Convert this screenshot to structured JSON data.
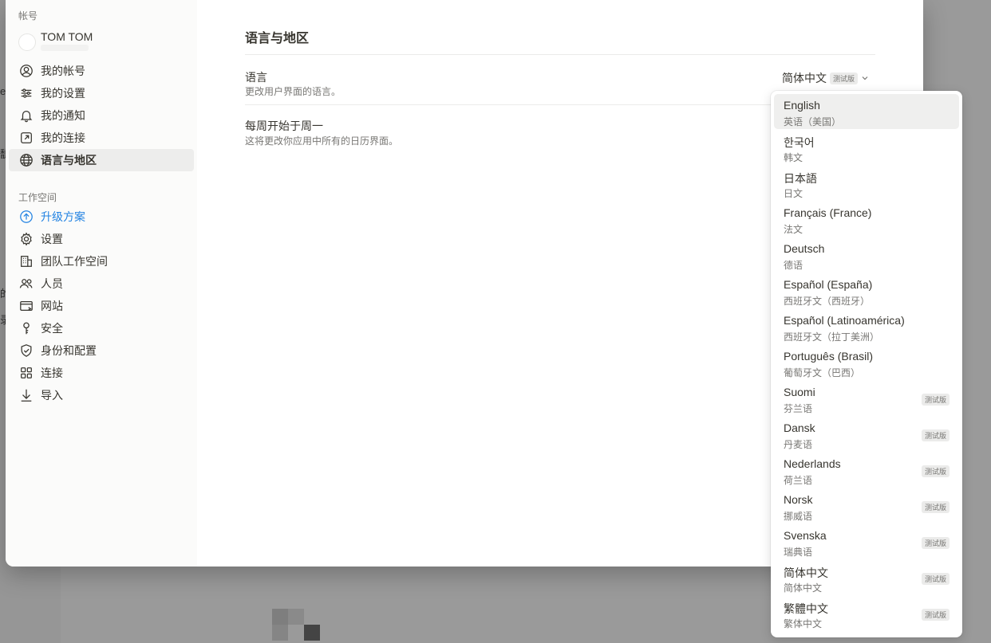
{
  "background": {
    "fragments": [
      "e",
      "馦",
      "的",
      "录"
    ]
  },
  "sidebar": {
    "account_section": "帐号",
    "account_name": "TOM TOM",
    "account_items": [
      {
        "label": "我的帐号",
        "icon": "user-circle-icon"
      },
      {
        "label": "我的设置",
        "icon": "sliders-icon"
      },
      {
        "label": "我的通知",
        "icon": "bell-icon"
      },
      {
        "label": "我的连接",
        "icon": "arrow-up-right-square-icon"
      },
      {
        "label": "语言与地区",
        "icon": "globe-icon",
        "active": true
      }
    ],
    "workspace_section": "工作空间",
    "workspace_items": [
      {
        "label": "升级方案",
        "icon": "upgrade-circle-icon",
        "accent": true
      },
      {
        "label": "设置",
        "icon": "gear-icon"
      },
      {
        "label": "团队工作空间",
        "icon": "building-icon"
      },
      {
        "label": "人员",
        "icon": "people-icon"
      },
      {
        "label": "网站",
        "icon": "browser-window-icon"
      },
      {
        "label": "安全",
        "icon": "key-icon"
      },
      {
        "label": "身份和配置",
        "icon": "shield-check-icon"
      },
      {
        "label": "连接",
        "icon": "grid-icon"
      },
      {
        "label": "导入",
        "icon": "download-arrow-icon"
      }
    ]
  },
  "main": {
    "title": "语言与地区",
    "language": {
      "title": "语言",
      "description": "更改用户界面的语言。",
      "selected": "简体中文",
      "badge": "测试版"
    },
    "week_start": {
      "title": "每周开始于周一",
      "description": "这将更改你应用中所有的日历界面。"
    }
  },
  "dropdown": {
    "options": [
      {
        "name": "English",
        "sub": "英语（美国）",
        "badge": "",
        "selected": true
      },
      {
        "name": "한국어",
        "sub": "韩文",
        "badge": ""
      },
      {
        "name": "日本語",
        "sub": "日文",
        "badge": ""
      },
      {
        "name": "Français (France)",
        "sub": "法文",
        "badge": ""
      },
      {
        "name": "Deutsch",
        "sub": "德语",
        "badge": ""
      },
      {
        "name": "Español (España)",
        "sub": "西班牙文（西班牙）",
        "badge": ""
      },
      {
        "name": "Español (Latinoamérica)",
        "sub": "西班牙文（拉丁美洲）",
        "badge": ""
      },
      {
        "name": "Português (Brasil)",
        "sub": "葡萄牙文（巴西）",
        "badge": ""
      },
      {
        "name": "Suomi",
        "sub": "芬兰语",
        "badge": "测试版"
      },
      {
        "name": "Dansk",
        "sub": "丹麦语",
        "badge": "测试版"
      },
      {
        "name": "Nederlands",
        "sub": "荷兰语",
        "badge": "测试版"
      },
      {
        "name": "Norsk",
        "sub": "挪威语",
        "badge": "测试版"
      },
      {
        "name": "Svenska",
        "sub": "瑞典语",
        "badge": "测试版"
      },
      {
        "name": "简体中文",
        "sub": "简体中文",
        "badge": "测试版"
      },
      {
        "name": "繁體中文",
        "sub": "繁体中文",
        "badge": "测试版"
      }
    ]
  },
  "colors": {
    "accent": "#2383e2",
    "sidebar_bg": "#fbfbfa",
    "active_bg": "#ededec",
    "overlay": "#8f8f8f"
  }
}
